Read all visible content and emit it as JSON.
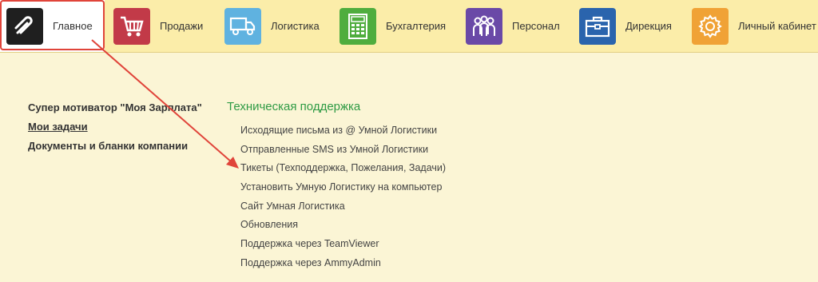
{
  "nav": {
    "sections": [
      {
        "label": "Главное",
        "icon": "paperclip-icon",
        "color": "#1f1f1f"
      },
      {
        "label": "Продажи",
        "icon": "shopping-cart-icon",
        "color": "#c23a48"
      },
      {
        "label": "Логистика",
        "icon": "truck-icon",
        "color": "#5fb2e0"
      },
      {
        "label": "Бухгалтерия",
        "icon": "calculator-icon",
        "color": "#4fad3e"
      },
      {
        "label": "Персонал",
        "icon": "people-icon",
        "color": "#6a49a7"
      },
      {
        "label": "Дирекция",
        "icon": "briefcase-icon",
        "color": "#2a64ad"
      },
      {
        "label": "Личный кабинет",
        "icon": "gear-icon",
        "color": "#f0a236"
      }
    ],
    "active": "Главное"
  },
  "left_links": [
    "Супер мотиватор \"Моя Зарплата\"",
    "Мои задачи",
    "Документы и бланки компании"
  ],
  "support": {
    "title": "Техническая поддержка",
    "items": [
      "Исходящие письма из @ Умной Логистики",
      "Отправленные SMS из Умной Логистики",
      "Тикеты (Техподдержка, Пожелания, Задачи)",
      "Установить Умную Логистику на компьютер",
      "Сайт Умная Логистика",
      "Обновления",
      "Поддержка через TeamViewer",
      "Поддержка через AmmyAdmin"
    ]
  },
  "annotation": {
    "color": "#e0443a"
  }
}
